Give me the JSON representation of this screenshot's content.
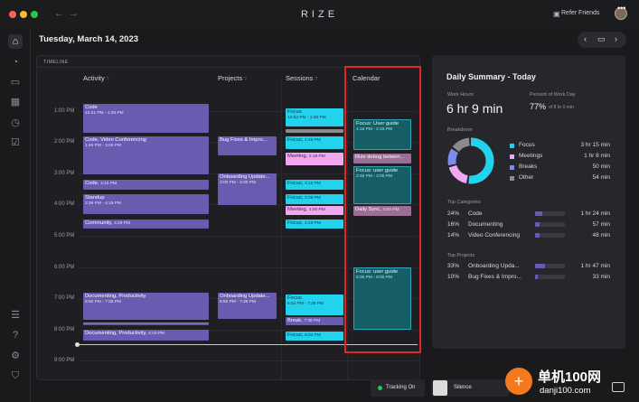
{
  "app": {
    "title": "RIZE",
    "refer_label": "Refer Friends",
    "nav_back": "←",
    "nav_forward": "→",
    "more": "•••"
  },
  "sidebar": {
    "icons": [
      "home-icon",
      "clock-icon",
      "folder-icon",
      "calendar-icon",
      "history-icon",
      "checklist-icon",
      "menu-icon",
      "help-icon",
      "settings-icon",
      "shield-icon"
    ]
  },
  "header": {
    "date": "Tuesday, March 14, 2023",
    "prev": "‹",
    "calendar_icon": "▭",
    "next": "›"
  },
  "timeline": {
    "label": "TIMELINE",
    "columns": {
      "activity": "Activity",
      "projects": "Projects",
      "sessions": "Sessions",
      "calendar": "Calendar"
    },
    "info_icon": "?",
    "hours": [
      "1:00 PM",
      "2:00 PM",
      "3:00 PM",
      "4:00 PM",
      "5:00 PM",
      "6:00 PM",
      "7:00 PM",
      "8:00 PM",
      "9:00 PM"
    ],
    "activity_blocks": [
      {
        "title": "Code",
        "time": "12:41 PM - 1:36 PM"
      },
      {
        "title": "Code, Video Conferencing",
        "time": "1:46 PM - 3:00 PM"
      },
      {
        "title": "Code",
        "time": "3:10 PM"
      },
      {
        "title": "Standup",
        "time": "3:39 PM - 4:19 PM"
      },
      {
        "title": "Community",
        "time": "4:29 PM"
      },
      {
        "title": "Documenting, Productivity",
        "time": "6:50 PM - 7:38 PM"
      },
      {
        "title": "Documenting, Productivity",
        "time": "8:03 PM"
      }
    ],
    "project_blocks": [
      {
        "title": "Bug Fixes & Impro..."
      },
      {
        "title": "Onboarding Update...",
        "time": "3:00 PM - 4:00 PM"
      },
      {
        "title": "Onboarding Update...",
        "time": "6:50 PM - 7:38 PM"
      }
    ],
    "session_blocks": [
      {
        "title": "Focus",
        "time": "12:54 PM - 1:36 PM"
      },
      {
        "title": "Focus",
        "time": "1:46 PM"
      },
      {
        "title": "Meeting",
        "time": "2:19 PM"
      },
      {
        "title": "Focus",
        "time": "3:10 PM"
      },
      {
        "title": "Focus",
        "time": "3:39 PM"
      },
      {
        "title": "Meeting",
        "time": "4:00 PM"
      },
      {
        "title": "Focus",
        "time": "4:19 PM"
      },
      {
        "title": "Focus",
        "time": "6:54 PM - 7:38 PM"
      },
      {
        "title": "Break",
        "time": "7:38 PM"
      },
      {
        "title": "Focus",
        "time": "8:03 PM"
      }
    ],
    "calendar_blocks": [
      {
        "title": "Focus: User guide",
        "time": "1:15 PM - 2:15 PM"
      },
      {
        "title": "Rize debug betwen...",
        "time": ""
      },
      {
        "title": "Focus: user guide",
        "time": "2:45 PM - 4:00 PM"
      },
      {
        "title": "Daily Sync",
        "time": "4:00 PM"
      },
      {
        "title": "Focus: user guide",
        "time": "6:00 PM - 8:00 PM"
      }
    ]
  },
  "summary": {
    "title": "Daily Summary - Today",
    "work_hours_label": "Work Hours",
    "work_hours_value": "6 hr 9 min",
    "percent_label": "Percent of Work Day",
    "percent_value": "77%",
    "percent_sub": "of 8 hr 0 min",
    "breakdown_label": "Breakdown",
    "breakdown": [
      {
        "name": "Focus",
        "value": "3 hr 15 min",
        "color": "#22d3ee",
        "minutes": 195
      },
      {
        "name": "Meetings",
        "value": "1 hr 8 min",
        "color": "#f0a8f0",
        "minutes": 68
      },
      {
        "name": "Breaks",
        "value": "50 min",
        "color": "#7b8cf0",
        "minutes": 50
      },
      {
        "name": "Other",
        "value": "54 min",
        "color": "#8a8a90",
        "minutes": 54
      }
    ],
    "top_categories_label": "Top Categories",
    "top_categories": [
      {
        "pct": "24%",
        "name": "Code",
        "value": "1 hr 24 min",
        "fill": 0.24
      },
      {
        "pct": "16%",
        "name": "Documenting",
        "value": "57 min",
        "fill": 0.16
      },
      {
        "pct": "14%",
        "name": "Video Conferencing",
        "value": "48 min",
        "fill": 0.14
      }
    ],
    "top_projects_label": "Top Projects",
    "top_projects": [
      {
        "pct": "33%",
        "name": "Onboarding Upda...",
        "value": "1 hr 47 min",
        "fill": 0.33
      },
      {
        "pct": "10%",
        "name": "Bug Fixes & Impro...",
        "value": "33 min",
        "fill": 0.1
      }
    ]
  },
  "bottom": {
    "tracking_label": "Tracking On",
    "silence_label": "Silence"
  },
  "watermark": {
    "main": "单机100网",
    "sub": "danji100.com",
    "logo": "+"
  }
}
